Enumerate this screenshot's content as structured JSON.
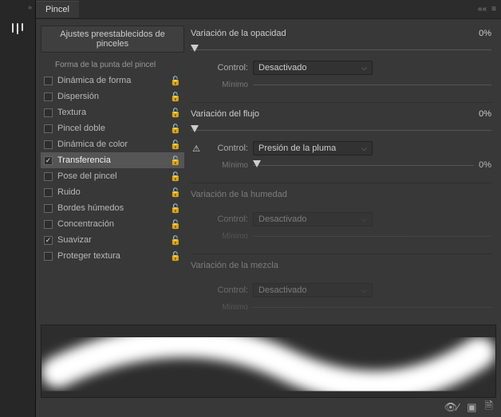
{
  "tab_title": "Pincel",
  "presets_button": "Ajustes preestablecidos de pinceles",
  "section_header": "Forma de la punta del pincel",
  "options": [
    {
      "label": "Dinámica de forma",
      "checked": false,
      "selected": false
    },
    {
      "label": "Dispersión",
      "checked": false,
      "selected": false
    },
    {
      "label": "Textura",
      "checked": false,
      "selected": false
    },
    {
      "label": "Pincel doble",
      "checked": false,
      "selected": false
    },
    {
      "label": "Dinámica de color",
      "checked": false,
      "selected": false
    },
    {
      "label": "Transferencia",
      "checked": true,
      "selected": true
    },
    {
      "label": "Pose del pincel",
      "checked": false,
      "selected": false
    },
    {
      "label": "Ruido",
      "checked": false,
      "selected": false
    },
    {
      "label": "Bordes húmedos",
      "checked": false,
      "selected": false
    },
    {
      "label": "Concentración",
      "checked": false,
      "selected": false
    },
    {
      "label": "Suavizar",
      "checked": true,
      "selected": false
    },
    {
      "label": "Proteger textura",
      "checked": false,
      "selected": false
    }
  ],
  "settings": {
    "opacity": {
      "title": "Variación de la opacidad",
      "value": "0%",
      "control_label": "Control:",
      "control_value": "Desactivado",
      "min_label": "Mínimo",
      "warn": false,
      "enabled": true
    },
    "flow": {
      "title": "Variación del flujo",
      "value": "0%",
      "control_label": "Control:",
      "control_value": "Presión de la pluma",
      "min_label": "Mínimo",
      "min_value": "0%",
      "warn": true,
      "enabled": true
    },
    "wetness": {
      "title": "Variación de la humedad",
      "control_label": "Control:",
      "control_value": "Desactivado",
      "min_label": "Mínimo",
      "enabled": false
    },
    "mix": {
      "title": "Variación de la mezcla",
      "control_label": "Control:",
      "control_value": "Desactivado",
      "min_label": "Mínimo",
      "enabled": false
    }
  }
}
